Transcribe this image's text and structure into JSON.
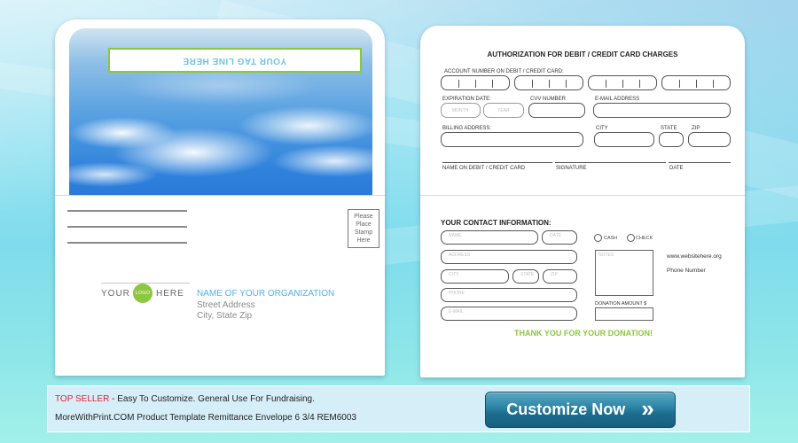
{
  "left_envelope": {
    "tagline": "YOUR TAG LINE HERE",
    "stamp_lines": [
      "Please",
      "Place",
      "Stamp",
      "Here"
    ],
    "logo": {
      "left": "YOUR",
      "center": "LOGO",
      "right": "HERE"
    },
    "organization": {
      "name": "NAME OF YOUR ORGANIZATION",
      "street": "Street Address",
      "city_state_zip": "City, State  Zip"
    }
  },
  "right_envelope": {
    "title": "AUTHORIZATION FOR DEBIT / CREDIT CARD CHARGES",
    "account_label": "ACCOUNT NUMBER ON DEBIT / CREDIT CARD:",
    "expiration_label": "EXPIRATION DATE:",
    "month_placeholder": "MONTH",
    "year_placeholder": "YEAR",
    "cvv_label": "CVV NUMBER",
    "email_label": "E-MAIL ADDRESS",
    "billing_label": "BILLING ADDRESS:",
    "city_label": "CITY",
    "state_label": "STATE",
    "zip_label": "ZIP",
    "name_on_card_label": "NAME ON DEBIT / CREDIT CARD",
    "signature_label": "SIGNATURE",
    "date_label": "DATE",
    "contact": {
      "title": "YOUR CONTACT INFORMATION:",
      "name_ph": "NAME",
      "date_ph": "DATE",
      "address_ph": "ADDRESS",
      "city_ph": "CITY",
      "state_ph": "STATE",
      "zip_ph": "ZIP",
      "phone_ph": "PHONE",
      "email_ph": "E-MAIL"
    },
    "payment_options": [
      "CASH",
      "CHECK"
    ],
    "notes_label": "NOTES",
    "donation_amount_label": "DONATION AMOUNT $",
    "website": "www.websitehere.org",
    "phone": "Phone Number",
    "thanks": "THANK YOU FOR YOUR DONATION!"
  },
  "info_bar": {
    "highlight": "TOP SELLER",
    "line1_rest": " - Easy To Customize. General Use For Fundraising.",
    "line2": "MoreWithPrint.COM Product Template Remittance Envelope 6 3/4 REM6003",
    "cta_label": "Customize Now",
    "cta_icon": "»"
  },
  "colors": {
    "accent_green": "#8dc63f",
    "accent_blue": "#4fb3e8",
    "highlight_red": "#e0203a",
    "cta_blue": "#1d6d8e"
  }
}
